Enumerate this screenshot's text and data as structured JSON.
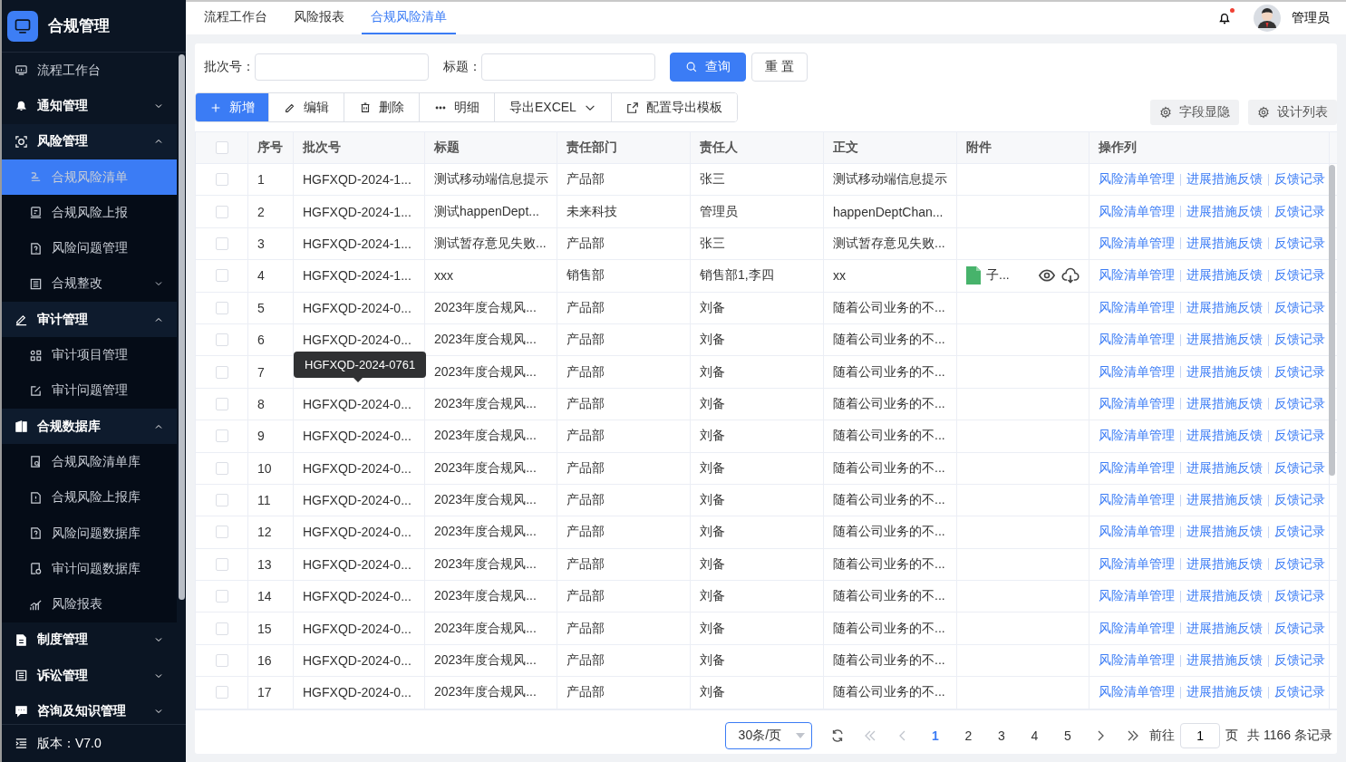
{
  "app": {
    "title": "合规管理",
    "version": "版本：V7.0"
  },
  "sidebar": {
    "items": [
      {
        "label": "流程工作台",
        "selected": false
      },
      {
        "label": "通知管理",
        "selected": false,
        "expanded": false
      },
      {
        "label": "风险管理",
        "selected": false,
        "expanded": true,
        "children": [
          {
            "label": "合规风险清单",
            "selected": true
          },
          {
            "label": "合规风险上报",
            "selected": false
          },
          {
            "label": "风险问题管理",
            "selected": false
          },
          {
            "label": "合规整改",
            "selected": false,
            "expanded": false
          }
        ]
      },
      {
        "label": "审计管理",
        "selected": false,
        "expanded": true,
        "children": [
          {
            "label": "审计项目管理",
            "selected": false
          },
          {
            "label": "审计问题管理",
            "selected": false
          }
        ]
      },
      {
        "label": "合规数据库",
        "selected": false,
        "expanded": true,
        "children": [
          {
            "label": "合规风险清单库",
            "selected": false
          },
          {
            "label": "合规风险上报库",
            "selected": false
          },
          {
            "label": "风险问题数据库",
            "selected": false
          },
          {
            "label": "审计问题数据库",
            "selected": false
          },
          {
            "label": "风险报表",
            "selected": false
          }
        ]
      },
      {
        "label": "制度管理",
        "selected": false,
        "expanded": false
      },
      {
        "label": "诉讼管理",
        "selected": false,
        "expanded": false
      },
      {
        "label": "咨询及知识管理",
        "selected": false,
        "expanded": false
      }
    ]
  },
  "tabs": [
    {
      "label": "流程工作台",
      "selected": false
    },
    {
      "label": "风险报表",
      "selected": false
    },
    {
      "label": "合规风险清单",
      "selected": true
    }
  ],
  "user": {
    "name": "管理员",
    "unread": true
  },
  "search": {
    "fields": [
      {
        "label": "批次号："
      },
      {
        "label": "标题："
      }
    ],
    "buttons": [
      {
        "label": "查询",
        "kind": "primary"
      },
      {
        "label": "重 置",
        "kind": "default"
      }
    ]
  },
  "toolbar": {
    "buttons": [
      {
        "label": "新增",
        "kind": "primary"
      },
      {
        "label": "编辑",
        "kind": "default"
      },
      {
        "label": "删除",
        "kind": "default"
      },
      {
        "label": "明细",
        "kind": "default"
      },
      {
        "label": "导出EXCEL",
        "kind": "dropdown"
      },
      {
        "label": "配置导出模板",
        "kind": "default"
      }
    ],
    "right": [
      {
        "label": "字段显隐"
      },
      {
        "label": "设计列表"
      }
    ]
  },
  "table": {
    "all_checked": false,
    "columns": [
      "序号",
      "批次号",
      "标题",
      "责任部门",
      "责任人",
      "正文",
      "附件",
      "操作列"
    ],
    "rows": [
      {
        "checked": false,
        "cells": [
          "1",
          "HGFXQD-2024-1...",
          "测试移动端信息提示",
          "产品部",
          "张三",
          "测试移动端信息提示"
        ],
        "actions": [
          "风险清单管理",
          "进展措施反馈",
          "反馈记录"
        ]
      },
      {
        "checked": false,
        "cells": [
          "2",
          "HGFXQD-2024-1...",
          "测试happenDept...",
          "未来科技",
          "管理员",
          "happenDeptChan..."
        ],
        "actions": [
          "风险清单管理",
          "进展措施反馈",
          "反馈记录"
        ]
      },
      {
        "checked": false,
        "cells": [
          "3",
          "HGFXQD-2024-1...",
          "测试暂存意见失败...",
          "产品部",
          "张三",
          "测试暂存意见失败..."
        ],
        "actions": [
          "风险清单管理",
          "进展措施反馈",
          "反馈记录"
        ]
      },
      {
        "checked": false,
        "cells": [
          "4",
          "HGFXQD-2024-1...",
          "xxx",
          "销售部",
          "销售部1,李四",
          "xx"
        ],
        "attachment": {
          "name": "子..."
        },
        "actions": [
          "风险清单管理",
          "进展措施反馈",
          "反馈记录"
        ]
      },
      {
        "checked": false,
        "cells": [
          "5",
          "HGFXQD-2024-0...",
          "2023年度合规风...",
          "产品部",
          "刘备",
          "随着公司业务的不..."
        ],
        "actions": [
          "风险清单管理",
          "进展措施反馈",
          "反馈记录"
        ]
      },
      {
        "checked": false,
        "cells": [
          "6",
          "HGFXQD-2024-0...",
          "2023年度合规风...",
          "产品部",
          "刘备",
          "随着公司业务的不..."
        ],
        "actions": [
          "风险清单管理",
          "进展措施反馈",
          "反馈记录"
        ]
      },
      {
        "checked": false,
        "cells": [
          "7",
          "",
          "2023年度合规风...",
          "产品部",
          "刘备",
          "随着公司业务的不..."
        ],
        "tooltip": "HGFXQD-2024-0761",
        "actions": [
          "风险清单管理",
          "进展措施反馈",
          "反馈记录"
        ]
      },
      {
        "checked": false,
        "cells": [
          "8",
          "HGFXQD-2024-0...",
          "2023年度合规风...",
          "产品部",
          "刘备",
          "随着公司业务的不..."
        ],
        "actions": [
          "风险清单管理",
          "进展措施反馈",
          "反馈记录"
        ]
      },
      {
        "checked": false,
        "cells": [
          "9",
          "HGFXQD-2024-0...",
          "2023年度合规风...",
          "产品部",
          "刘备",
          "随着公司业务的不..."
        ],
        "actions": [
          "风险清单管理",
          "进展措施反馈",
          "反馈记录"
        ]
      },
      {
        "checked": false,
        "cells": [
          "10",
          "HGFXQD-2024-0...",
          "2023年度合规风...",
          "产品部",
          "刘备",
          "随着公司业务的不..."
        ],
        "actions": [
          "风险清单管理",
          "进展措施反馈",
          "反馈记录"
        ]
      },
      {
        "checked": false,
        "cells": [
          "11",
          "HGFXQD-2024-0...",
          "2023年度合规风...",
          "产品部",
          "刘备",
          "随着公司业务的不..."
        ],
        "actions": [
          "风险清单管理",
          "进展措施反馈",
          "反馈记录"
        ]
      },
      {
        "checked": false,
        "cells": [
          "12",
          "HGFXQD-2024-0...",
          "2023年度合规风...",
          "产品部",
          "刘备",
          "随着公司业务的不..."
        ],
        "actions": [
          "风险清单管理",
          "进展措施反馈",
          "反馈记录"
        ]
      },
      {
        "checked": false,
        "cells": [
          "13",
          "HGFXQD-2024-0...",
          "2023年度合规风...",
          "产品部",
          "刘备",
          "随着公司业务的不..."
        ],
        "actions": [
          "风险清单管理",
          "进展措施反馈",
          "反馈记录"
        ]
      },
      {
        "checked": false,
        "cells": [
          "14",
          "HGFXQD-2024-0...",
          "2023年度合规风...",
          "产品部",
          "刘备",
          "随着公司业务的不..."
        ],
        "actions": [
          "风险清单管理",
          "进展措施反馈",
          "反馈记录"
        ]
      },
      {
        "checked": false,
        "cells": [
          "15",
          "HGFXQD-2024-0...",
          "2023年度合规风...",
          "产品部",
          "刘备",
          "随着公司业务的不..."
        ],
        "actions": [
          "风险清单管理",
          "进展措施反馈",
          "反馈记录"
        ]
      },
      {
        "checked": false,
        "cells": [
          "16",
          "HGFXQD-2024-0...",
          "2023年度合规风...",
          "产品部",
          "刘备",
          "随着公司业务的不..."
        ],
        "actions": [
          "风险清单管理",
          "进展措施反馈",
          "反馈记录"
        ]
      },
      {
        "checked": false,
        "cells": [
          "17",
          "HGFXQD-2024-0...",
          "2023年度合规风...",
          "产品部",
          "刘备",
          "随着公司业务的不..."
        ],
        "actions": [
          "风险清单管理",
          "进展措施反馈",
          "反馈记录"
        ]
      }
    ]
  },
  "pagination": {
    "page_size": "30条/页",
    "pages": [
      {
        "label": "1",
        "selected": true
      },
      {
        "label": "2",
        "selected": false
      },
      {
        "label": "3",
        "selected": false
      },
      {
        "label": "4",
        "selected": false
      },
      {
        "label": "5",
        "selected": false
      }
    ],
    "goto_label": "前往",
    "goto_value": "1",
    "page_unit": "页",
    "total": "共 1166 条记录"
  }
}
